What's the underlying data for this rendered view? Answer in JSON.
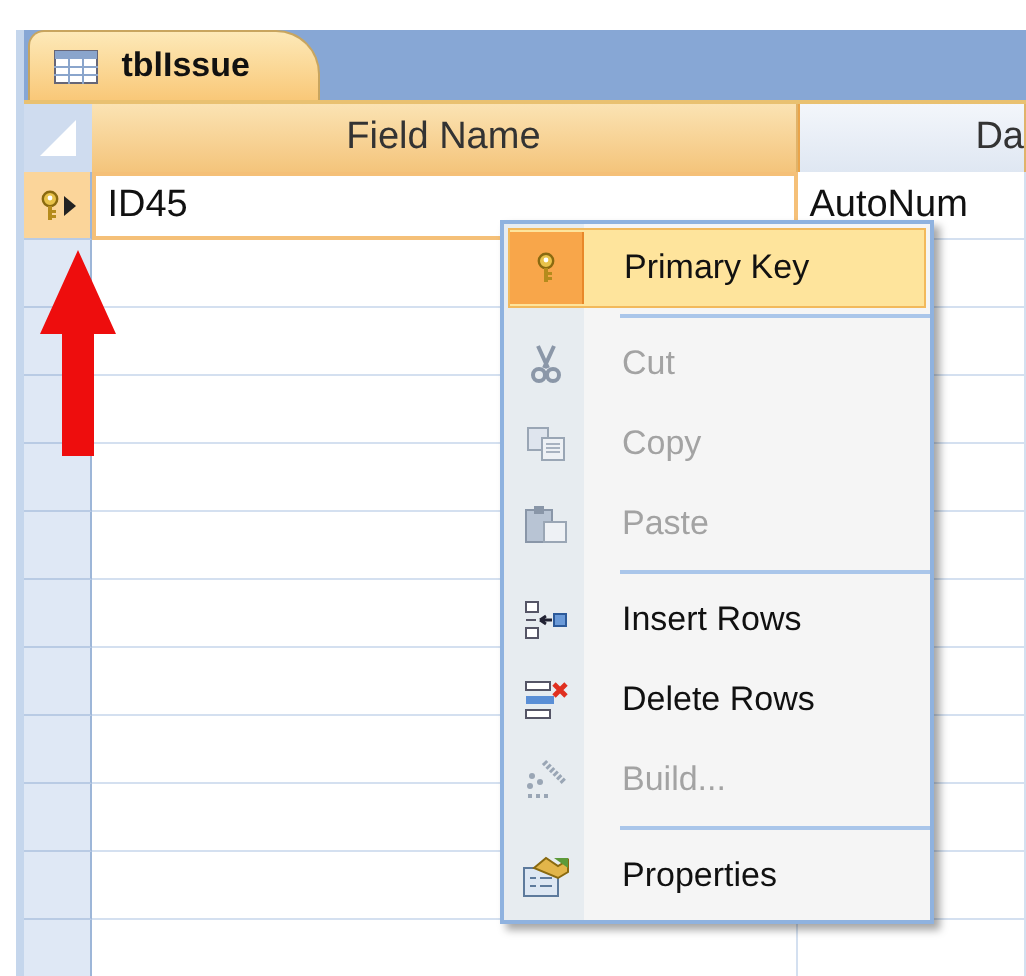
{
  "tab": {
    "title": "tblIssue",
    "selected": true
  },
  "table": {
    "columns": [
      "Field Name",
      "Da"
    ],
    "rows": [
      {
        "field_name": "ID45",
        "data_type": "AutoNum",
        "primary_key": true,
        "current": true
      }
    ]
  },
  "context_menu": {
    "items": [
      {
        "label": "Primary Key",
        "selected": true,
        "disabled": false,
        "separator_after": true
      },
      {
        "label": "Cut",
        "selected": false,
        "disabled": true,
        "separator_after": false
      },
      {
        "label": "Copy",
        "selected": false,
        "disabled": true,
        "separator_after": false
      },
      {
        "label": "Paste",
        "selected": false,
        "disabled": true,
        "separator_after": true
      },
      {
        "label": "Insert Rows",
        "selected": false,
        "disabled": false,
        "separator_after": false
      },
      {
        "label": "Delete Rows",
        "selected": false,
        "disabled": false,
        "separator_after": false
      },
      {
        "label": "Build...",
        "selected": false,
        "disabled": true,
        "separator_after": true
      },
      {
        "label": "Properties",
        "selected": false,
        "disabled": false,
        "separator_after": false
      }
    ]
  }
}
